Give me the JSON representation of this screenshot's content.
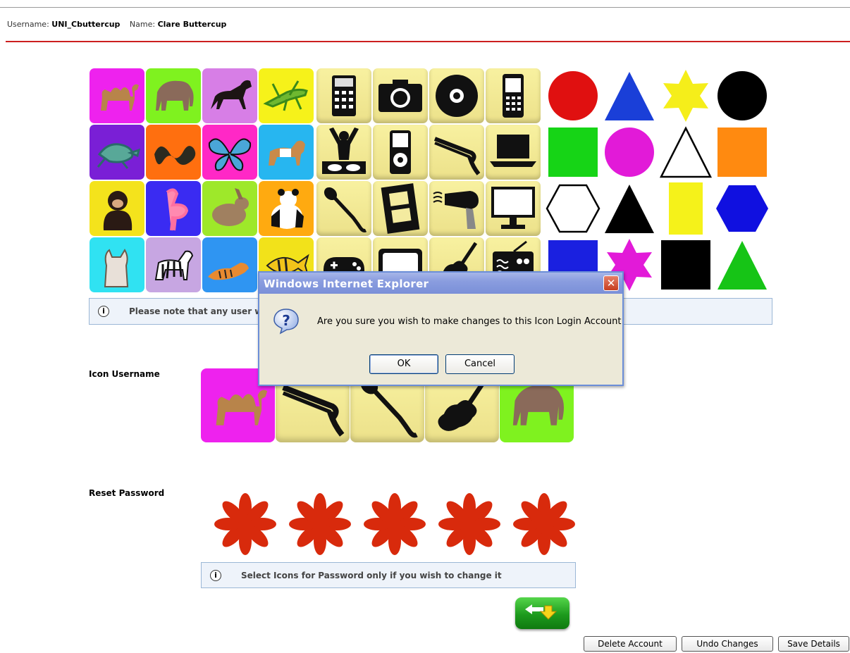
{
  "header": {
    "username_label": "Username:",
    "username_value": "UNI_Cbuttercup",
    "name_label": "Name:",
    "name_value": "Clare Buttercup"
  },
  "icon_grid": {
    "animals": [
      {
        "icon": "camel-icon",
        "bg": "#ee22ee"
      },
      {
        "icon": "elephant-icon",
        "bg": "#7ff21f"
      },
      {
        "icon": "horse-icon",
        "bg": "#d77ee6"
      },
      {
        "icon": "grasshopper-icon",
        "bg": "#f6f21a"
      },
      {
        "icon": "turtle-icon",
        "bg": "#7a1fd6"
      },
      {
        "icon": "snake-icon",
        "bg": "#ff6f0f"
      },
      {
        "icon": "butterfly-icon",
        "bg": "#ff28c6"
      },
      {
        "icon": "dog-icon",
        "bg": "#27b6f0"
      },
      {
        "icon": "chimpanzee-icon",
        "bg": "#f4e31c"
      },
      {
        "icon": "flamingo-icon",
        "bg": "#3a2bf2"
      },
      {
        "icon": "rabbit-icon",
        "bg": "#9ee82a"
      },
      {
        "icon": "panda-icon",
        "bg": "#ffaa10"
      },
      {
        "icon": "cat-icon",
        "bg": "#30e2f2"
      },
      {
        "icon": "zebra-icon",
        "bg": "#c7a6e2"
      },
      {
        "icon": "tiger-icon",
        "bg": "#2f95f2"
      },
      {
        "icon": "fish-icon",
        "bg": "#f2e21a"
      }
    ],
    "devices": [
      "calculator-icon",
      "camera-icon",
      "cd-icon",
      "mobile-phone-icon",
      "dj-icon",
      "ipod-icon",
      "hair-straightener-icon",
      "laptop-icon",
      "microphone-icon",
      "film-icon",
      "hair-dryer-icon",
      "monitor-icon",
      "gamepad-icon",
      "tv-icon",
      "guitar-icon",
      "radio-icon"
    ],
    "shapes": [
      {
        "shape": "circle",
        "color": "#e01010"
      },
      {
        "shape": "triangle",
        "color": "#1a3fd8"
      },
      {
        "shape": "star6",
        "color": "#f5ee1a"
      },
      {
        "shape": "circle",
        "color": "#000000"
      },
      {
        "shape": "square",
        "color": "#16d416"
      },
      {
        "shape": "circle",
        "color": "#e21ad8"
      },
      {
        "shape": "triangle",
        "color": "#ffffff"
      },
      {
        "shape": "square",
        "color": "#ff8a10"
      },
      {
        "shape": "hexagon",
        "color": "#ffffff"
      },
      {
        "shape": "triangle",
        "color": "#000000"
      },
      {
        "shape": "rect",
        "color": "#f5f21a"
      },
      {
        "shape": "hexagon",
        "color": "#1010e0"
      },
      {
        "shape": "square",
        "color": "#1a20e0"
      },
      {
        "shape": "star6",
        "color": "#e21ad8"
      },
      {
        "shape": "square",
        "color": "#000000"
      },
      {
        "shape": "triangle",
        "color": "#16c416"
      }
    ]
  },
  "notes": {
    "grid_note": "Please note that any user w",
    "password_note": "Select Icons for Password only if you wish to change it"
  },
  "form": {
    "icon_username_label": "Icon Username",
    "reset_password_label": "Reset Password",
    "selected_icons": [
      {
        "icon": "camel-icon",
        "bg": "#ee22ee"
      },
      {
        "icon": "hair-straightener-icon",
        "bg": "device"
      },
      {
        "icon": "microphone-icon",
        "bg": "device"
      },
      {
        "icon": "guitar-icon",
        "bg": "device"
      },
      {
        "icon": "elephant-icon",
        "bg": "#7ff21f"
      }
    ],
    "password_mask_color": "#d82a0c"
  },
  "buttons": {
    "delete": "Delete Account",
    "undo": "Undo Changes",
    "save": "Save Details"
  },
  "dialog": {
    "title": "Windows Internet Explorer",
    "close_symbol": "✕",
    "message": "Are you sure you wish to make changes to this Icon Login Account",
    "ok": "OK",
    "cancel": "Cancel"
  }
}
